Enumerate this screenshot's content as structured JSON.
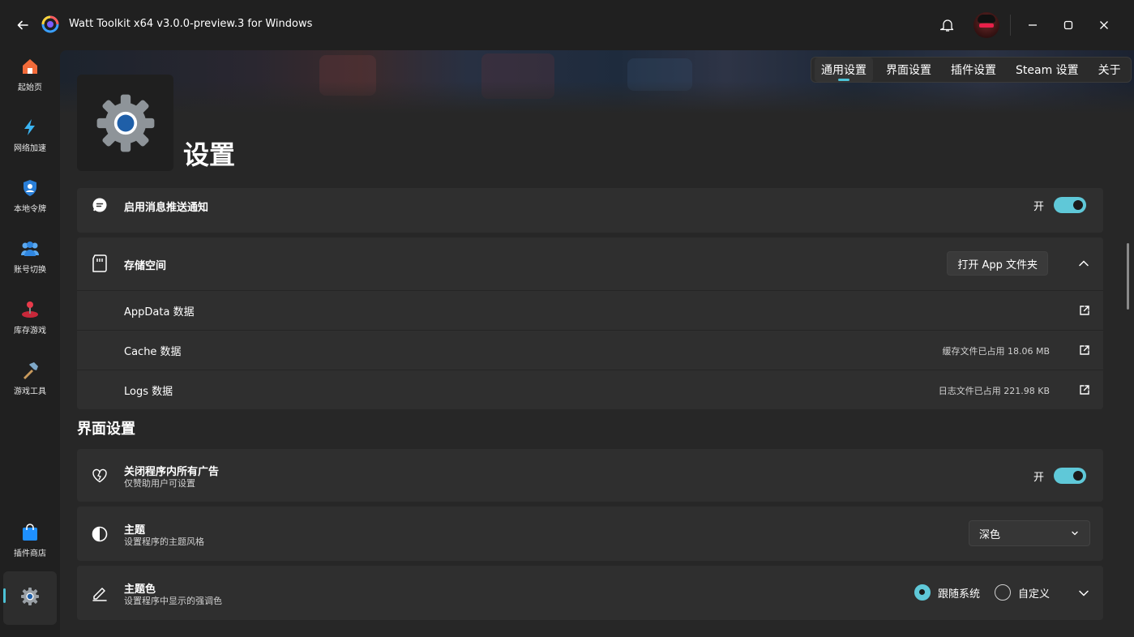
{
  "window": {
    "title": "Watt Toolkit x64 v3.0.0-preview.3 for Windows"
  },
  "sidebar": {
    "items": [
      {
        "label": "起始页",
        "icon": "home-icon"
      },
      {
        "label": "网络加速",
        "icon": "lightning-icon"
      },
      {
        "label": "本地令牌",
        "icon": "shield-user-icon"
      },
      {
        "label": "账号切换",
        "icon": "users-icon"
      },
      {
        "label": "库存游戏",
        "icon": "joystick-icon"
      },
      {
        "label": "游戏工具",
        "icon": "hammer-icon"
      },
      {
        "label": "插件商店",
        "icon": "shopping-bag-icon"
      },
      {
        "label": "",
        "icon": "gear-icon"
      }
    ]
  },
  "tabs": [
    {
      "label": "通用设置",
      "active": true
    },
    {
      "label": "界面设置",
      "active": false
    },
    {
      "label": "插件设置",
      "active": false
    },
    {
      "label": "Steam 设置",
      "active": false
    },
    {
      "label": "关于",
      "active": false
    }
  ],
  "page": {
    "title": "设置"
  },
  "general": {
    "notify": {
      "title": "启用消息推送通知",
      "state_label": "开",
      "on": true
    },
    "storage": {
      "title": "存储空间",
      "open_button": "打开 App 文件夹",
      "appdata": {
        "title": "AppData 数据"
      },
      "cache": {
        "title": "Cache 数据",
        "meta": "缓存文件已占用 18.06 MB"
      },
      "logs": {
        "title": "Logs 数据",
        "meta": "日志文件已占用 221.98 KB"
      }
    }
  },
  "ui_section": {
    "title": "界面设置",
    "ads": {
      "title": "关闭程序内所有广告",
      "subtitle": "仅赞助用户可设置",
      "state_label": "开",
      "on": true
    },
    "theme": {
      "title": "主题",
      "subtitle": "设置程序的主题风格",
      "value": "深色"
    },
    "accent": {
      "title": "主题色",
      "subtitle": "设置程序中显示的强调色",
      "options": [
        {
          "label": "跟随系统",
          "checked": true
        },
        {
          "label": "自定义",
          "checked": false
        }
      ]
    }
  },
  "colors": {
    "accent": "#5fc8d8",
    "background": "#202020",
    "card": "#2f2f2f"
  }
}
